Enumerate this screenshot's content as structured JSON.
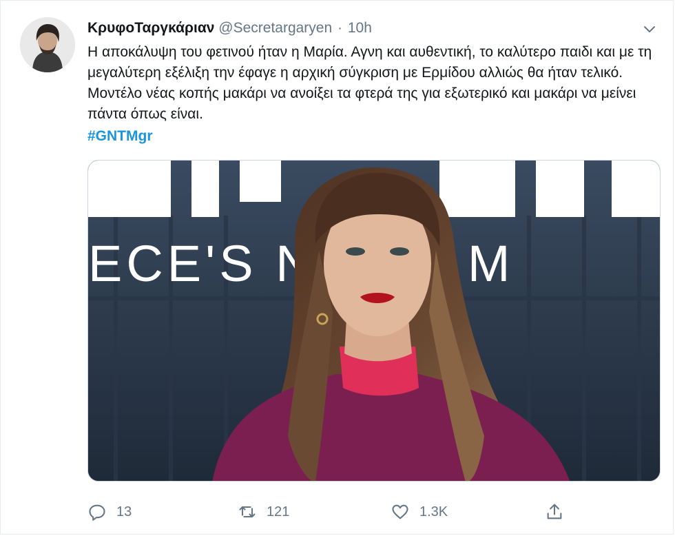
{
  "tweet": {
    "display_name": "ΚρυφοΤαργκάριαν",
    "handle": "@Secretargaryen",
    "separator": "·",
    "time": "10h",
    "text": "Η αποκάλυψη του φετινού ήταν η Μαρία. Αγνη και αυθεντική, το καλύτερο παιδι και με τη μεγαλύτερη εξέλιξη την έφαγε η αρχική σύγκριση με Ερμίδου αλλιώς θα ήταν τελικό.  Μοντέλο νέας κοπής μακάρι να ανοίξει τα φτερά της για εξωτερικό και μακάρι να μείνει πάντα όπως είναι.",
    "hashtag": "#GNTMgr"
  },
  "media": {
    "banner_text": "ECE'S N    TOP M",
    "colors": {
      "background": "#2d3a4b",
      "sweater": "#7a1f4f",
      "collar": "#e0305a",
      "lips": "#b3121f",
      "hair": "#5a3a28"
    }
  },
  "actions": {
    "reply_count": "13",
    "retweet_count": "121",
    "like_count": "1.3K"
  },
  "icons": {
    "reply": "reply-icon",
    "retweet": "retweet-icon",
    "like": "heart-icon",
    "share": "share-icon",
    "caret": "chevron-down-icon"
  },
  "colors": {
    "accent": "#1b95e0",
    "muted": "#657786",
    "text": "#14171a"
  }
}
